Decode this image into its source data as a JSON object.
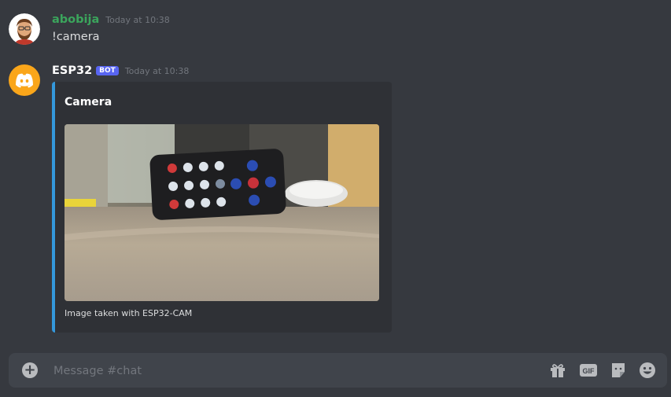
{
  "messages": [
    {
      "username": "abobija",
      "username_color": "#3ba55c",
      "timestamp": "Today at 10:38",
      "text": "!camera",
      "avatar": "bearded-man-avatar"
    },
    {
      "username": "ESP32",
      "username_color": "#ffffff",
      "bot_tag": "BOT",
      "timestamp": "Today at 10:38",
      "avatar": "discord-logo-avatar",
      "avatar_bg": "#faa61a",
      "embed": {
        "title": "Camera",
        "image": "ir-remote-keyes-photo",
        "footer": "Image taken with ESP32-CAM",
        "accent": "#3498db"
      }
    }
  ],
  "composer": {
    "placeholder": "Message #chat",
    "icons": [
      "add-icon",
      "gift-icon",
      "gif-icon",
      "sticker-icon",
      "emoji-icon"
    ]
  }
}
